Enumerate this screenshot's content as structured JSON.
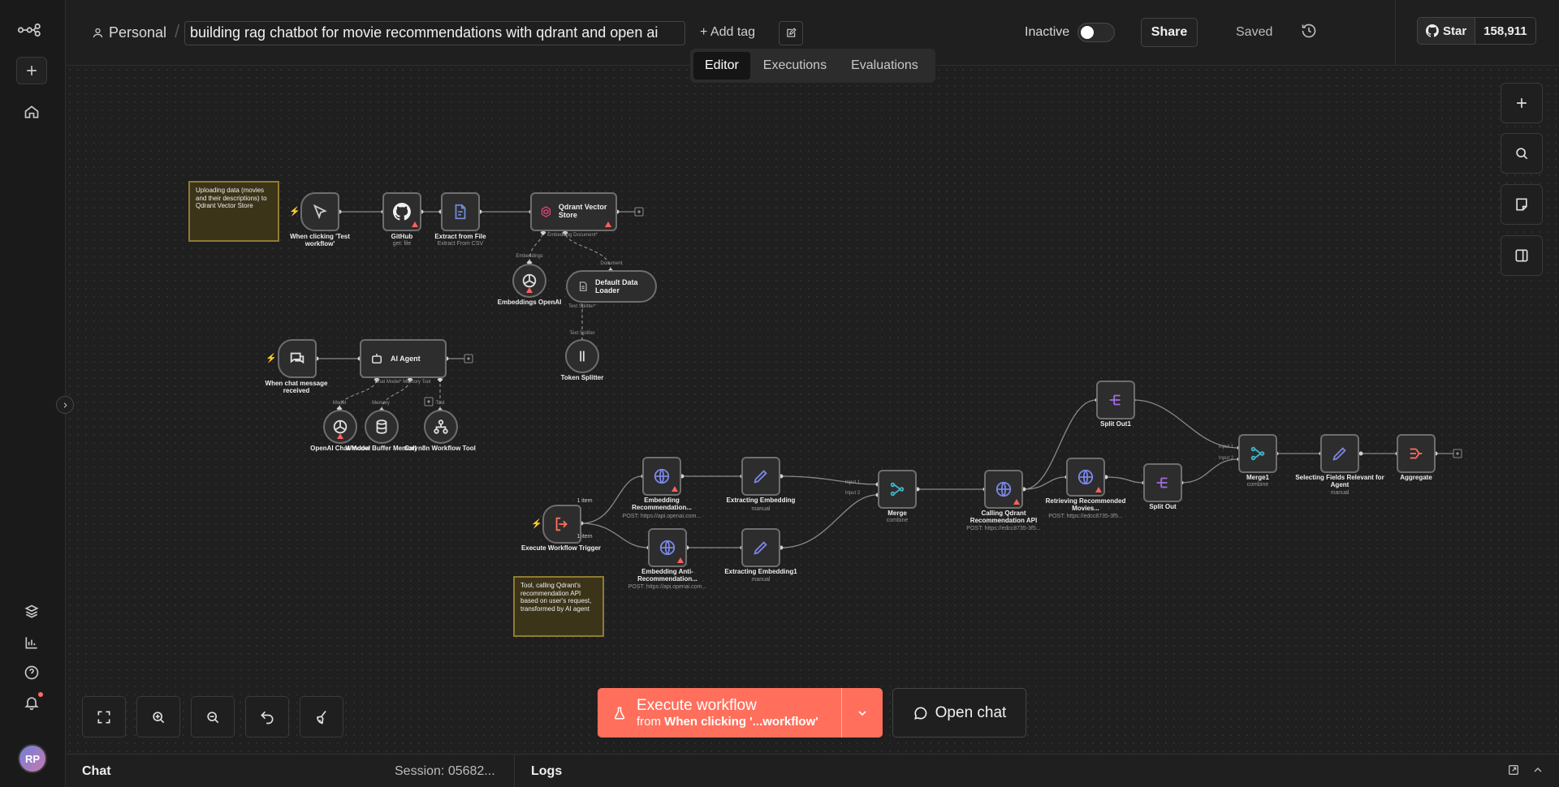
{
  "header": {
    "project": "Personal",
    "workflow_name": "building rag chatbot for movie recommendations with qdrant and open ai",
    "add_tag": "+ Add tag",
    "status": "Inactive",
    "share": "Share",
    "saved": "Saved",
    "github": {
      "label": "Star",
      "count": "158,911"
    }
  },
  "tabs": [
    "Editor",
    "Executions",
    "Evaluations"
  ],
  "sticky_notes": [
    "Uploading data (movies and their descriptions) to Qdrant Vector Store",
    "Tool, calling Qdrant's recommendation API based on user's request, transformed by AI agent"
  ],
  "nodes": {
    "manual_trigger": {
      "label": "When clicking 'Test workflow'"
    },
    "github": {
      "label": "GitHub",
      "sub": "get: file"
    },
    "extract": {
      "label": "Extract from File",
      "sub": "Extract From CSV"
    },
    "qdrant": {
      "label": "Qdrant Vector Store",
      "ports": "Embedding  Document*"
    },
    "emb_openai": {
      "label": "Embeddings OpenAI",
      "port": "Embeddings"
    },
    "data_loader": {
      "label": "Default Data Loader",
      "port": "Document",
      "port2": "Text Splitter*"
    },
    "token_splitter": {
      "label": "Token Splitter",
      "port": "Text Splitter"
    },
    "chat_trigger": {
      "label": "When chat message received"
    },
    "ai_agent": {
      "label": "AI Agent",
      "ports": "Chat Model*   Memory   Tool"
    },
    "openai_chat": {
      "label": "OpenAI Chat Model",
      "port": "Model"
    },
    "memory": {
      "label": "Window Buffer Memory",
      "port": "Memory"
    },
    "tool": {
      "label": "Call n8n Workflow Tool",
      "port": "Tool"
    },
    "exec_trigger": {
      "label": "Execute Workflow Trigger"
    },
    "emb_rec": {
      "label": "Embedding Recommendation...",
      "sub": "POST: https://api.openai.com..."
    },
    "emb_anti": {
      "label": "Embedding Anti-Recommendation...",
      "sub": "POST: https://api.openai.com..."
    },
    "extract_emb": {
      "label": "Extracting Embedding",
      "sub": "manual"
    },
    "extract_emb1": {
      "label": "Extracting Embedding1",
      "sub": "manual"
    },
    "merge": {
      "label": "Merge",
      "sub": "combine",
      "in1": "Input 1",
      "in2": "Input 2"
    },
    "calling_qdrant": {
      "label": "Calling Qdrant Recommendation API",
      "sub": "POST: https://edcc8735-3f5..."
    },
    "retrieving": {
      "label": "Retrieving Recommended Movies...",
      "sub": "POST: https://edcc8735-3f5..."
    },
    "split_out1": {
      "label": "Split Out1"
    },
    "split_out": {
      "label": "Split Out"
    },
    "merge1": {
      "label": "Merge1",
      "sub": "combine",
      "in1": "Input 1",
      "in2": "Input 2"
    },
    "selecting": {
      "label": "Selecting Fields Relevant for Agent",
      "sub": "manual"
    },
    "aggregate": {
      "label": "Aggregate"
    }
  },
  "edge_labels": {
    "item1": "1 item",
    "item2": "1 item"
  },
  "execute": {
    "line1": "Execute workflow",
    "line2_prefix": "from",
    "line2_bold": "When clicking '...workflow'"
  },
  "open_chat": "Open chat",
  "bottom": {
    "chat": "Chat",
    "session": "Session: 05682...",
    "logs": "Logs"
  },
  "user": {
    "initials": "RP"
  },
  "colors": {
    "accent": "#ff6f5c",
    "sticky_bg": "#3b3419",
    "node_border": "#6e6e6e",
    "warning": "#ff5f5f"
  }
}
